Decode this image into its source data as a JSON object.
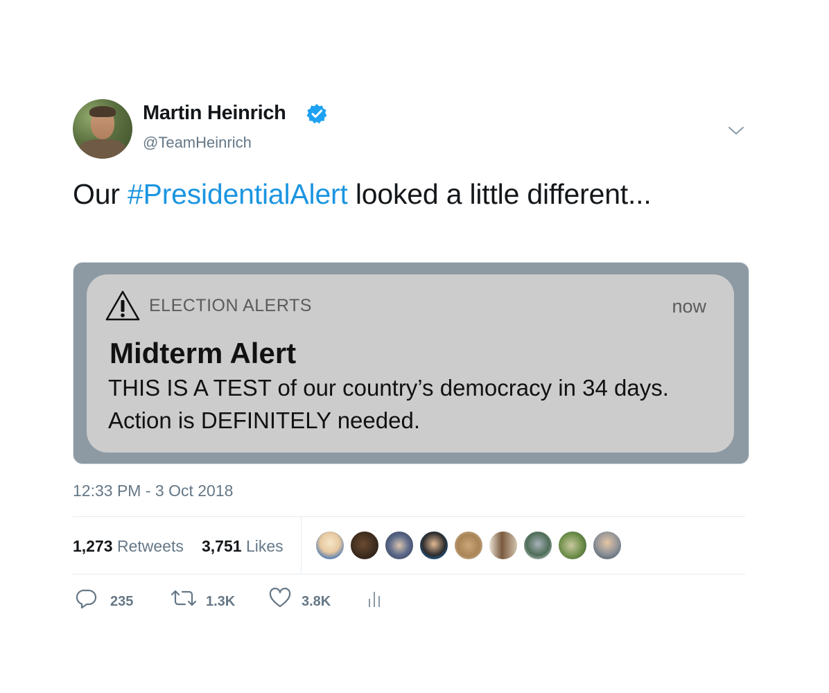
{
  "author": {
    "name": "Martin Heinrich",
    "handle": "@TeamHeinrich",
    "verified": true
  },
  "tweet": {
    "text_before": "Our ",
    "hashtag": "#PresidentialAlert",
    "text_after": " looked a little different..."
  },
  "media": {
    "app_name": "ELECTION ALERTS",
    "time": "now",
    "title": "Midterm Alert",
    "body": "THIS IS A TEST of our country’s democracy in 34 days. Action is DEFINITELY needed."
  },
  "timestamp": "12:33 PM - 3 Oct 2018",
  "stats": {
    "retweets_count": "1,273",
    "retweets_label": "Retweets",
    "likes_count": "3,751",
    "likes_label": "Likes"
  },
  "actions": {
    "reply_count": "235",
    "retweet_count": "1.3K",
    "like_count": "3.8K"
  },
  "icons": {
    "verified": "verified-badge-icon",
    "caret": "chevron-down-icon",
    "warning": "warning-triangle-icon",
    "reply": "reply-icon",
    "retweet": "retweet-icon",
    "like": "heart-icon",
    "analytics": "analytics-icon"
  },
  "colors": {
    "link": "#1b95e0",
    "secondary_text": "#657786",
    "verified": "#1da1f2"
  }
}
